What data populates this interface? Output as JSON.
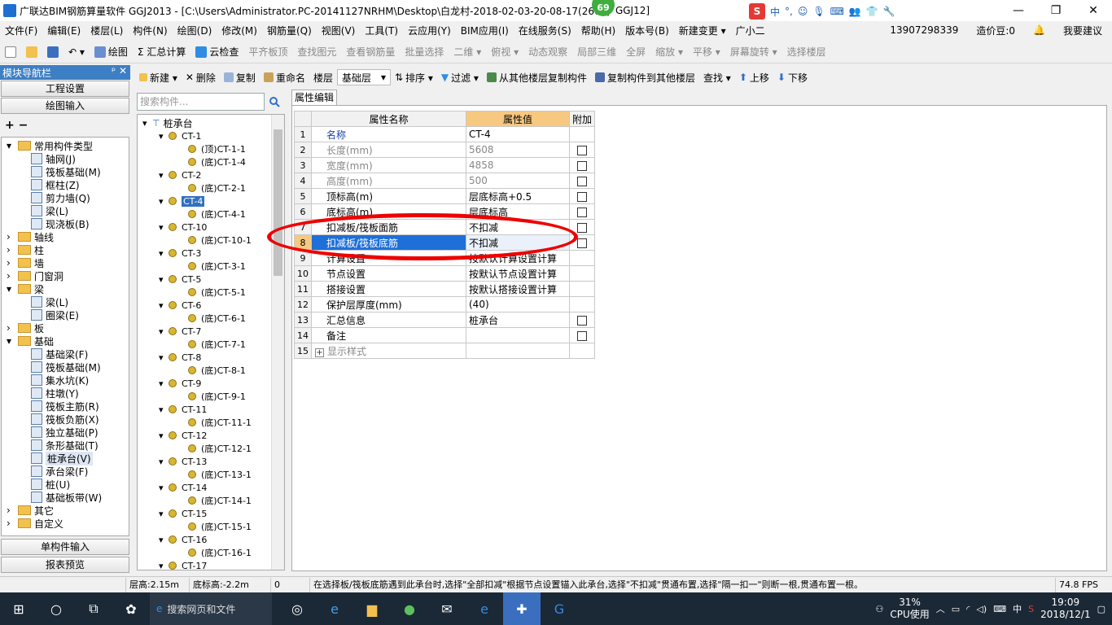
{
  "title": {
    "text": "广联达BIM钢筋算量软件 GGJ2013 - [C:\\Users\\Administrator.PC-20141127NRHM\\Desktop\\白龙村-2018-02-03-20-08-17(2661)",
    "suffix": "GGJ12]",
    "badge": "69"
  },
  "ime": {
    "s": "S",
    "items": [
      "中",
      "°,",
      "☺",
      "🎙",
      "⌨",
      "👥",
      "👕",
      "🔧"
    ]
  },
  "window_buttons": [
    "—",
    "❐",
    "✕"
  ],
  "menu": [
    "文件(F)",
    "编辑(E)",
    "楼层(L)",
    "构件(N)",
    "绘图(D)",
    "修改(M)",
    "钢筋量(Q)",
    "视图(V)",
    "工具(T)",
    "云应用(Y)",
    "BIM应用(I)",
    "在线服务(S)",
    "帮助(H)",
    "版本号(B)",
    "新建变更 ▾",
    "广小二"
  ],
  "menu_right": {
    "phone": "13907298339",
    "credit": "造价豆:0",
    "suggest": "我要建议"
  },
  "toolbar1": [
    {
      "label": "绘图",
      "disabled": false
    },
    {
      "label": "Σ 汇总计算",
      "disabled": false
    },
    {
      "label": "云检查",
      "disabled": false
    },
    {
      "label": "平齐板顶",
      "disabled": true
    },
    {
      "label": "查找图元",
      "disabled": true
    },
    {
      "label": "查看钢筋量",
      "disabled": true
    },
    {
      "label": "批量选择",
      "disabled": true
    },
    {
      "label": "二维 ▾",
      "disabled": true
    },
    {
      "label": "俯视 ▾",
      "disabled": true
    },
    {
      "label": "动态观察",
      "disabled": true
    },
    {
      "label": "局部三维",
      "disabled": true
    },
    {
      "label": "全屏",
      "disabled": true
    },
    {
      "label": "缩放 ▾",
      "disabled": true
    },
    {
      "label": "平移 ▾",
      "disabled": true
    },
    {
      "label": "屏幕旋转 ▾",
      "disabled": true
    },
    {
      "label": "选择楼层",
      "disabled": true
    }
  ],
  "nav": {
    "header": "模块导航栏",
    "pin": "ᵖ ✕",
    "btn_project": "工程设置",
    "btn_draw": "绘图输入",
    "btn_single": "单构件输入",
    "btn_report": "报表预览",
    "tree": [
      {
        "label": "常用构件类型",
        "lvl": 0,
        "exp": "▾",
        "folder": true
      },
      {
        "label": "轴网(J)",
        "lvl": 1
      },
      {
        "label": "筏板基础(M)",
        "lvl": 1
      },
      {
        "label": "框柱(Z)",
        "lvl": 1
      },
      {
        "label": "剪力墙(Q)",
        "lvl": 1
      },
      {
        "label": "梁(L)",
        "lvl": 1
      },
      {
        "label": "现浇板(B)",
        "lvl": 1
      },
      {
        "label": "轴线",
        "lvl": 0,
        "exp": "›",
        "folder": true
      },
      {
        "label": "柱",
        "lvl": 0,
        "exp": "›",
        "folder": true
      },
      {
        "label": "墙",
        "lvl": 0,
        "exp": "›",
        "folder": true
      },
      {
        "label": "门窗洞",
        "lvl": 0,
        "exp": "›",
        "folder": true
      },
      {
        "label": "梁",
        "lvl": 0,
        "exp": "▾",
        "folder": true
      },
      {
        "label": "梁(L)",
        "lvl": 1
      },
      {
        "label": "圈梁(E)",
        "lvl": 1
      },
      {
        "label": "板",
        "lvl": 0,
        "exp": "›",
        "folder": true
      },
      {
        "label": "基础",
        "lvl": 0,
        "exp": "▾",
        "folder": true
      },
      {
        "label": "基础梁(F)",
        "lvl": 1
      },
      {
        "label": "筏板基础(M)",
        "lvl": 1
      },
      {
        "label": "集水坑(K)",
        "lvl": 1
      },
      {
        "label": "柱墩(Y)",
        "lvl": 1
      },
      {
        "label": "筏板主筋(R)",
        "lvl": 1
      },
      {
        "label": "筏板负筋(X)",
        "lvl": 1
      },
      {
        "label": "独立基础(P)",
        "lvl": 1
      },
      {
        "label": "条形基础(T)",
        "lvl": 1
      },
      {
        "label": "桩承台(V)",
        "lvl": 1,
        "sel": true
      },
      {
        "label": "承台梁(F)",
        "lvl": 1
      },
      {
        "label": "桩(U)",
        "lvl": 1
      },
      {
        "label": "基础板带(W)",
        "lvl": 1
      },
      {
        "label": "其它",
        "lvl": 0,
        "exp": "›",
        "folder": true
      },
      {
        "label": "自定义",
        "lvl": 0,
        "exp": "›",
        "folder": true
      }
    ]
  },
  "toolbar2": {
    "new": "新建 ▾",
    "delete": "删除",
    "copy": "复制",
    "rename": "重命名",
    "floor_label": "楼层",
    "floor_value": "基础层",
    "sort": "排序 ▾",
    "filter": "过滤 ▾",
    "copy_from": "从其他楼层复制构件",
    "copy_to": "复制构件到其他楼层",
    "find": "查找 ▾",
    "up": "上移",
    "down": "下移"
  },
  "search_placeholder": "搜索构件...",
  "comp_tree": [
    {
      "label": "桩承台",
      "lvl": 0
    },
    {
      "label": "CT-1",
      "lvl": 1
    },
    {
      "label": "(顶)CT-1-1",
      "lvl": 2
    },
    {
      "label": "(底)CT-1-4",
      "lvl": 2
    },
    {
      "label": "CT-2",
      "lvl": 1
    },
    {
      "label": "(底)CT-2-1",
      "lvl": 2
    },
    {
      "label": "CT-4",
      "lvl": 1,
      "sel": true
    },
    {
      "label": "(底)CT-4-1",
      "lvl": 2
    },
    {
      "label": "CT-10",
      "lvl": 1
    },
    {
      "label": "(底)CT-10-1",
      "lvl": 2
    },
    {
      "label": "CT-3",
      "lvl": 1
    },
    {
      "label": "(底)CT-3-1",
      "lvl": 2
    },
    {
      "label": "CT-5",
      "lvl": 1
    },
    {
      "label": "(底)CT-5-1",
      "lvl": 2
    },
    {
      "label": "CT-6",
      "lvl": 1
    },
    {
      "label": "(底)CT-6-1",
      "lvl": 2
    },
    {
      "label": "CT-7",
      "lvl": 1
    },
    {
      "label": "(底)CT-7-1",
      "lvl": 2
    },
    {
      "label": "CT-8",
      "lvl": 1
    },
    {
      "label": "(底)CT-8-1",
      "lvl": 2
    },
    {
      "label": "CT-9",
      "lvl": 1
    },
    {
      "label": "(底)CT-9-1",
      "lvl": 2
    },
    {
      "label": "CT-11",
      "lvl": 1
    },
    {
      "label": "(底)CT-11-1",
      "lvl": 2
    },
    {
      "label": "CT-12",
      "lvl": 1
    },
    {
      "label": "(底)CT-12-1",
      "lvl": 2
    },
    {
      "label": "CT-13",
      "lvl": 1
    },
    {
      "label": "(底)CT-13-1",
      "lvl": 2
    },
    {
      "label": "CT-14",
      "lvl": 1
    },
    {
      "label": "(底)CT-14-1",
      "lvl": 2
    },
    {
      "label": "CT-15",
      "lvl": 1
    },
    {
      "label": "(底)CT-15-1",
      "lvl": 2
    },
    {
      "label": "CT-16",
      "lvl": 1
    },
    {
      "label": "(底)CT-16-1",
      "lvl": 2
    },
    {
      "label": "CT-17",
      "lvl": 1
    }
  ],
  "prop": {
    "tab": "属性编辑",
    "col_name": "属性名称",
    "col_value": "属性值",
    "col_extra": "附加",
    "rows": [
      {
        "n": "1",
        "name": "名称",
        "value": "CT-4",
        "chk": false,
        "style": "blue"
      },
      {
        "n": "2",
        "name": "长度(mm)",
        "value": "5608",
        "chk": true,
        "style": "grey"
      },
      {
        "n": "3",
        "name": "宽度(mm)",
        "value": "4858",
        "chk": true,
        "style": "grey"
      },
      {
        "n": "4",
        "name": "高度(mm)",
        "value": "500",
        "chk": true,
        "style": "grey"
      },
      {
        "n": "5",
        "name": "顶标高(m)",
        "value": "层底标高+0.5",
        "chk": true,
        "style": ""
      },
      {
        "n": "6",
        "name": "底标高(m)",
        "value": "层底标高",
        "chk": true,
        "style": ""
      },
      {
        "n": "7",
        "name": "扣减板/筏板面筋",
        "value": "不扣减",
        "chk": true,
        "style": ""
      },
      {
        "n": "8",
        "name": "扣减板/筏板底筋",
        "value": "不扣减",
        "chk": true,
        "style": "hl"
      },
      {
        "n": "9",
        "name": "计算设置",
        "value": "按默认计算设置计算",
        "chk": false,
        "style": ""
      },
      {
        "n": "10",
        "name": "节点设置",
        "value": "按默认节点设置计算",
        "chk": false,
        "style": ""
      },
      {
        "n": "11",
        "name": "搭接设置",
        "value": "按默认搭接设置计算",
        "chk": false,
        "style": ""
      },
      {
        "n": "12",
        "name": "保护层厚度(mm)",
        "value": "(40)",
        "chk": false,
        "style": ""
      },
      {
        "n": "13",
        "name": "汇总信息",
        "value": "桩承台",
        "chk": true,
        "style": ""
      },
      {
        "n": "14",
        "name": "备注",
        "value": "",
        "chk": true,
        "style": ""
      },
      {
        "n": "15",
        "name": "显示样式",
        "value": "",
        "chk": false,
        "style": "grey",
        "expander": "+"
      }
    ]
  },
  "status": {
    "floor_h": "层高:2.15m",
    "bottom": "底标高:-2.2m",
    "zero": "0",
    "hint": "在选择板/筏板底筋遇到此承台时,选择\"全部扣减\"根据节点设置锚入此承台,选择\"不扣减\"贯通布置,选择\"隔一扣一\"则断一根,贯通布置一根。",
    "fps": "74.8 FPS"
  },
  "taskbar": {
    "search": "搜索网页和文件",
    "cpu": "31%",
    "cpu_label": "CPU使用",
    "ime": "中",
    "time": "19:09",
    "date": "2018/12/1"
  }
}
